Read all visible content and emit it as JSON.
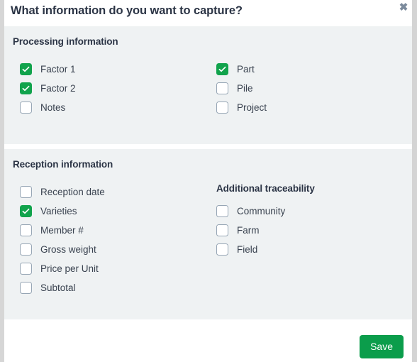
{
  "dialog": {
    "title": "What information do you want to capture?",
    "close_label": "✖",
    "close_icon": "close-icon",
    "accent_green": "#11a34c",
    "save_button_green": "#0b9d4b",
    "section_background": "#eff2f3",
    "text_color": "#2b3445"
  },
  "sections": [
    {
      "heading": "Processing information",
      "left_items": [
        {
          "label": "Factor 1",
          "checked": true
        },
        {
          "label": "Factor 2",
          "checked": true
        },
        {
          "label": "Notes",
          "checked": false
        }
      ],
      "right_heading": "",
      "right_items": [
        {
          "label": "Part",
          "checked": true
        },
        {
          "label": "Pile",
          "checked": false
        },
        {
          "label": "Project",
          "checked": false
        }
      ]
    },
    {
      "heading": "Reception information",
      "left_items": [
        {
          "label": "Reception date",
          "checked": false
        },
        {
          "label": "Varieties",
          "checked": true
        },
        {
          "label": "Member #",
          "checked": false
        },
        {
          "label": "Gross weight",
          "checked": false
        },
        {
          "label": "Price per Unit",
          "checked": false
        },
        {
          "label": "Subtotal",
          "checked": false
        }
      ],
      "right_heading": "Additional traceability",
      "right_items": [
        {
          "label": "Community",
          "checked": false
        },
        {
          "label": "Farm",
          "checked": false
        },
        {
          "label": "Field",
          "checked": false
        }
      ]
    }
  ],
  "footer": {
    "save_label": "Save"
  }
}
